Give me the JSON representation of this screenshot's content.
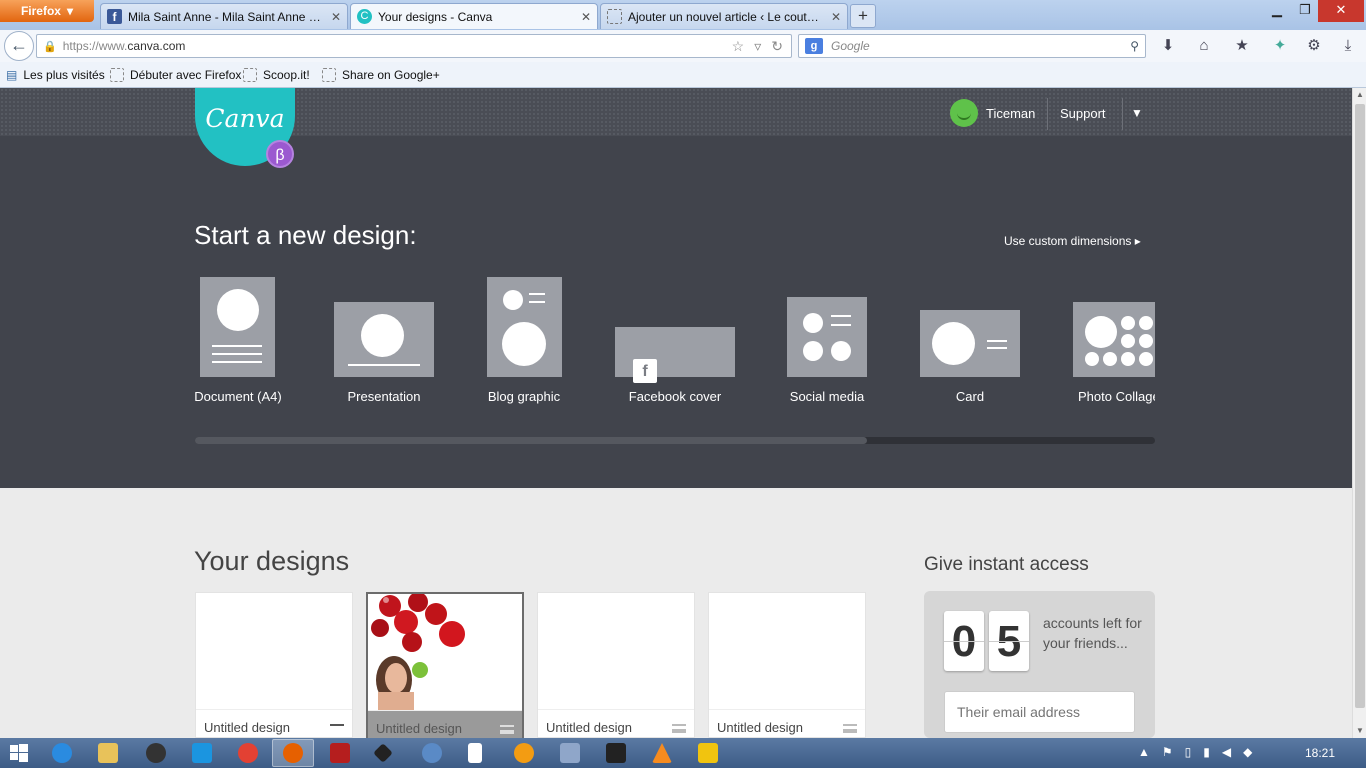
{
  "browser": {
    "menu_button": "Firefox",
    "tabs": [
      {
        "label": "Mila Saint Anne - Mila Saint Anne a p...",
        "favicon": "facebook-icon"
      },
      {
        "label": "Your designs - Canva",
        "favicon": "canva-icon"
      },
      {
        "label": "Ajouter un nouvel article ‹ Le coutela...",
        "favicon": "blank-page-icon"
      }
    ],
    "url_prefix": "https://www.",
    "url_domain": "canva.com",
    "search_placeholder": "Google",
    "bookmarks": [
      "Les plus visités",
      "Débuter avec Firefox",
      "Scoop.it!",
      "Share on Google+"
    ]
  },
  "header": {
    "logo_text": "Canva",
    "beta_badge": "β",
    "user_name": "Ticeman",
    "support_label": "Support"
  },
  "hero": {
    "title": "Start a new design:",
    "custom_link": "Use custom dimensions",
    "design_types": [
      "Document (A4)",
      "Presentation",
      "Blog graphic",
      "Facebook cover",
      "Social media",
      "Card",
      "Photo Collage"
    ],
    "scroll_progress": 0.7
  },
  "designs": {
    "title": "Your designs",
    "cards": [
      {
        "title": "Untitled design"
      },
      {
        "title": "Untitled design"
      },
      {
        "title": "Untitled design"
      },
      {
        "title": "Untitled design"
      }
    ]
  },
  "invite": {
    "title": "Give instant access",
    "digit_1": "0",
    "digit_2": "5",
    "accounts_text": "accounts left for your friends...",
    "email_placeholder": "Their email address"
  },
  "taskbar": {
    "clock": "18:21"
  },
  "colors": {
    "canva_teal": "#22c1c3",
    "beta_purple": "#9b59d0",
    "hero_bg": "#41444c"
  }
}
